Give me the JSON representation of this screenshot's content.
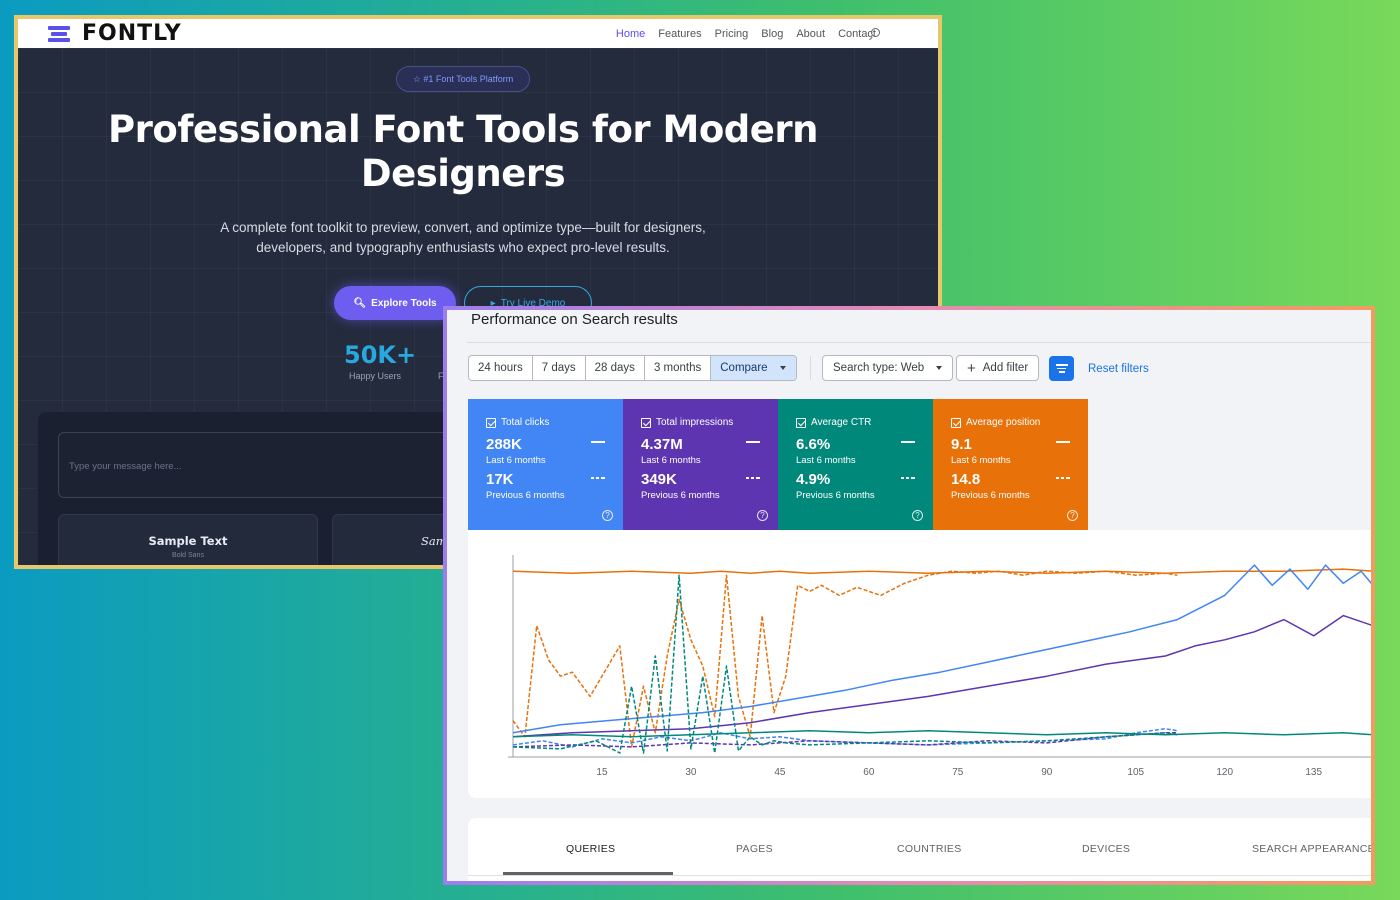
{
  "fontly": {
    "logo": "FONTLY",
    "nav": [
      "Home",
      "Features",
      "Pricing",
      "Blog",
      "About",
      "Contact"
    ],
    "badge": "☆ #1 Font Tools Platform",
    "title": "Professional Font Tools for Modern Designers",
    "subtitle": "A complete font toolkit to preview, convert, and optimize type—built for designers, developers, and typography enthusiasts who expect pro-level results.",
    "primary_cta": "Explore Tools",
    "secondary_cta": "Try Live Demo",
    "stat_value": "50K+",
    "stat_label": "Happy Users",
    "stat2_label_partial": "F",
    "input_placeholder": "Type your message here...",
    "cards": [
      {
        "title": "Sample Text",
        "subtitle": "Bold Sans"
      },
      {
        "title": "Sam",
        "subtitle": ""
      }
    ],
    "colors": {
      "accent": "#6d5ef0",
      "secondary": "#3aa8e6",
      "hero_bg": "#232b3c"
    }
  },
  "gsc": {
    "title": "Performance on Search results",
    "date_ranges": [
      "24 hours",
      "7 days",
      "28 days",
      "3 months"
    ],
    "compare_label": "Compare",
    "search_type": "Search type: Web",
    "add_filter": "Add filter",
    "reset_filters": "Reset filters",
    "metrics": [
      {
        "label": "Total clicks",
        "current": "288K",
        "current_period": "Last 6 months",
        "previous": "17K",
        "previous_period": "Previous 6 months",
        "color": "#4285f4"
      },
      {
        "label": "Total impressions",
        "current": "4.37M",
        "current_period": "Last 6 months",
        "previous": "349K",
        "previous_period": "Previous 6 months",
        "color": "#5e35b1"
      },
      {
        "label": "Average CTR",
        "current": "6.6%",
        "current_period": "Last 6 months",
        "previous": "4.9%",
        "previous_period": "Previous 6 months",
        "color": "#00897b"
      },
      {
        "label": "Average position",
        "current": "9.1",
        "current_period": "Last 6 months",
        "previous": "14.8",
        "previous_period": "Previous 6 months",
        "color": "#e8710a"
      }
    ],
    "tabs": [
      "QUERIES",
      "PAGES",
      "COUNTRIES",
      "DEVICES",
      "SEARCH APPEARANCE"
    ],
    "selected_tab": "QUERIES"
  },
  "chart_data": {
    "type": "line",
    "x_ticks": [
      15,
      30,
      45,
      60,
      75,
      90,
      105,
      120,
      135
    ],
    "xlim": [
      0,
      145
    ],
    "ylim": [
      0,
      1
    ],
    "grid": false,
    "series": [
      {
        "color": "#e8710a",
        "dashed": false,
        "x": [
          0,
          10,
          20,
          30,
          35,
          40,
          45,
          50,
          60,
          70,
          80,
          90,
          100,
          110,
          120,
          130,
          140,
          145
        ],
        "y": [
          0.92,
          0.91,
          0.92,
          0.91,
          0.92,
          0.91,
          0.92,
          0.91,
          0.92,
          0.91,
          0.92,
          0.91,
          0.92,
          0.91,
          0.92,
          0.92,
          0.93,
          0.92
        ]
      },
      {
        "color": "#e8710a",
        "dashed": true,
        "x": [
          0,
          2,
          4,
          6,
          8,
          10,
          13,
          16,
          18,
          20,
          22,
          24,
          26,
          28,
          30,
          32,
          34,
          36,
          38,
          40,
          42,
          44,
          46,
          48,
          50,
          52,
          55,
          58,
          62,
          66,
          70,
          74,
          78,
          82,
          86,
          90,
          95,
          100,
          105,
          110,
          112
        ],
        "y": [
          0.18,
          0.1,
          0.65,
          0.48,
          0.4,
          0.42,
          0.3,
          0.45,
          0.55,
          0.05,
          0.35,
          0.12,
          0.5,
          0.78,
          0.58,
          0.45,
          0.2,
          0.9,
          0.3,
          0.1,
          0.7,
          0.22,
          0.4,
          0.85,
          0.82,
          0.85,
          0.8,
          0.84,
          0.8,
          0.86,
          0.9,
          0.92,
          0.91,
          0.92,
          0.9,
          0.92,
          0.91,
          0.92,
          0.9,
          0.91,
          0.9
        ]
      },
      {
        "color": "#4285f4",
        "dashed": false,
        "x": [
          0,
          8,
          16,
          24,
          32,
          40,
          48,
          56,
          64,
          72,
          80,
          88,
          96,
          104,
          112,
          120,
          125,
          128,
          131,
          134,
          137,
          140,
          143,
          145
        ],
        "y": [
          0.12,
          0.16,
          0.18,
          0.2,
          0.22,
          0.25,
          0.29,
          0.33,
          0.38,
          0.42,
          0.47,
          0.52,
          0.57,
          0.62,
          0.68,
          0.8,
          0.95,
          0.85,
          0.93,
          0.83,
          0.95,
          0.86,
          0.92,
          0.85
        ]
      },
      {
        "color": "#4285f4",
        "dashed": true,
        "x": [
          0,
          5,
          10,
          15,
          20,
          25,
          30,
          35,
          40,
          45,
          50,
          60,
          70,
          80,
          90,
          100,
          105,
          110,
          112
        ],
        "y": [
          0.06,
          0.08,
          0.05,
          0.09,
          0.07,
          0.1,
          0.08,
          0.12,
          0.09,
          0.1,
          0.08,
          0.07,
          0.06,
          0.07,
          0.08,
          0.09,
          0.12,
          0.14,
          0.13
        ]
      },
      {
        "color": "#5e35b1",
        "dashed": false,
        "x": [
          0,
          10,
          20,
          30,
          40,
          50,
          60,
          70,
          80,
          90,
          100,
          110,
          115,
          120,
          125,
          130,
          135,
          140,
          145
        ],
        "y": [
          0.1,
          0.12,
          0.13,
          0.14,
          0.17,
          0.22,
          0.26,
          0.3,
          0.35,
          0.4,
          0.46,
          0.5,
          0.55,
          0.58,
          0.62,
          0.68,
          0.6,
          0.7,
          0.65
        ]
      },
      {
        "color": "#5e35b1",
        "dashed": true,
        "x": [
          0,
          10,
          20,
          30,
          40,
          50,
          60,
          70,
          80,
          90,
          100,
          105,
          110,
          112
        ],
        "y": [
          0.05,
          0.06,
          0.05,
          0.07,
          0.06,
          0.08,
          0.07,
          0.06,
          0.08,
          0.07,
          0.1,
          0.11,
          0.12,
          0.12
        ]
      },
      {
        "color": "#00897b",
        "dashed": false,
        "x": [
          0,
          10,
          20,
          30,
          40,
          50,
          60,
          70,
          80,
          90,
          100,
          110,
          120,
          130,
          140,
          145
        ],
        "y": [
          0.1,
          0.11,
          0.1,
          0.11,
          0.12,
          0.13,
          0.12,
          0.13,
          0.12,
          0.11,
          0.12,
          0.11,
          0.12,
          0.11,
          0.12,
          0.11
        ]
      },
      {
        "color": "#00897b",
        "dashed": true,
        "x": [
          0,
          8,
          14,
          18,
          20,
          22,
          24,
          26,
          28,
          30,
          32,
          34,
          36,
          38,
          40,
          42,
          44,
          46,
          50,
          60,
          70,
          80,
          90,
          100,
          110,
          112
        ],
        "y": [
          0.05,
          0.04,
          0.08,
          0.02,
          0.35,
          0.02,
          0.5,
          0.03,
          0.9,
          0.04,
          0.4,
          0.02,
          0.45,
          0.03,
          0.1,
          0.06,
          0.08,
          0.07,
          0.06,
          0.07,
          0.08,
          0.07,
          0.08,
          0.1,
          0.12,
          0.11
        ]
      }
    ]
  }
}
